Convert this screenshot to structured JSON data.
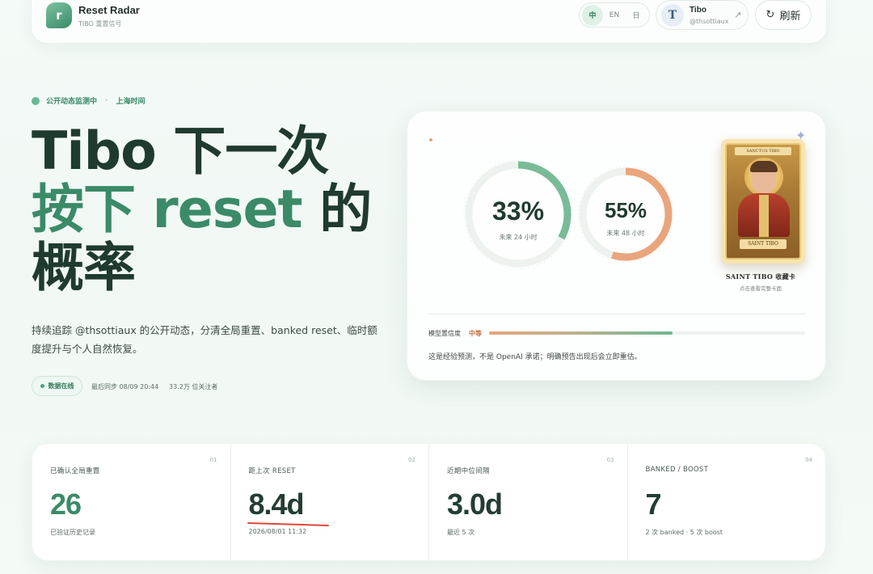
{
  "brand": {
    "name": "Reset Radar",
    "subtitle": "TIBO 重置信号",
    "logo_glyph": "r"
  },
  "lang": {
    "options": [
      "中",
      "EN",
      "日"
    ],
    "active": "中"
  },
  "profile": {
    "avatar_letter": "T",
    "name": "Tibo",
    "handle": "@thsottiaux"
  },
  "refresh_label": "刷新",
  "hero": {
    "status_text": "公开动态监测中",
    "timezone": "上海时间",
    "title_line1": "Tibo 下一次",
    "title_line2": "按下 reset 的",
    "title_line3": "概率",
    "description": "持续追踪 @thsottiaux 的公开动态，分清全局重置、banked reset、临时额度提升与个人自然恢复。",
    "online_badge": "数据在线",
    "last_sync": "最后同步 08/09 20:44",
    "followers": "33.2万 位关注者"
  },
  "prediction": {
    "ring24": {
      "value": "33%",
      "fraction": 0.33,
      "label": "未来 24 小时"
    },
    "ring48": {
      "value": "55%",
      "fraction": 0.55,
      "label": "未来 48 小时"
    },
    "card": {
      "top_text": "SANCTUS TIBO",
      "plate_text": "SAINT TIBO",
      "title": "SAINT TIBO 收藏卡",
      "subtitle": "点击查看完整卡面"
    },
    "confidence_label": "模型置信度",
    "confidence_value": "中等",
    "confidence_fraction": 0.58,
    "disclaimer": "这是经验预测，不是 OpenAI 承诺；明确预告出现后会立即重估。"
  },
  "stats": [
    {
      "index": "01",
      "label": "已确认全局重置",
      "value": "26",
      "sub": "已验证历史记录"
    },
    {
      "index": "02",
      "label": "距上次 RESET",
      "value": "8.4d",
      "sub": "2026/08/01 11:32"
    },
    {
      "index": "03",
      "label": "近期中位间隔",
      "value": "3.0d",
      "sub": "最近 5 次"
    },
    {
      "index": "04",
      "label": "BANKED / BOOST",
      "value": "7",
      "sub": "2 次 banked · 5 次 boost"
    }
  ],
  "colors": {
    "accent_green": "#3b8a68",
    "dark_text": "#1f3a2e",
    "orange": "#e7a57e",
    "underline_red": "#e2453d"
  }
}
